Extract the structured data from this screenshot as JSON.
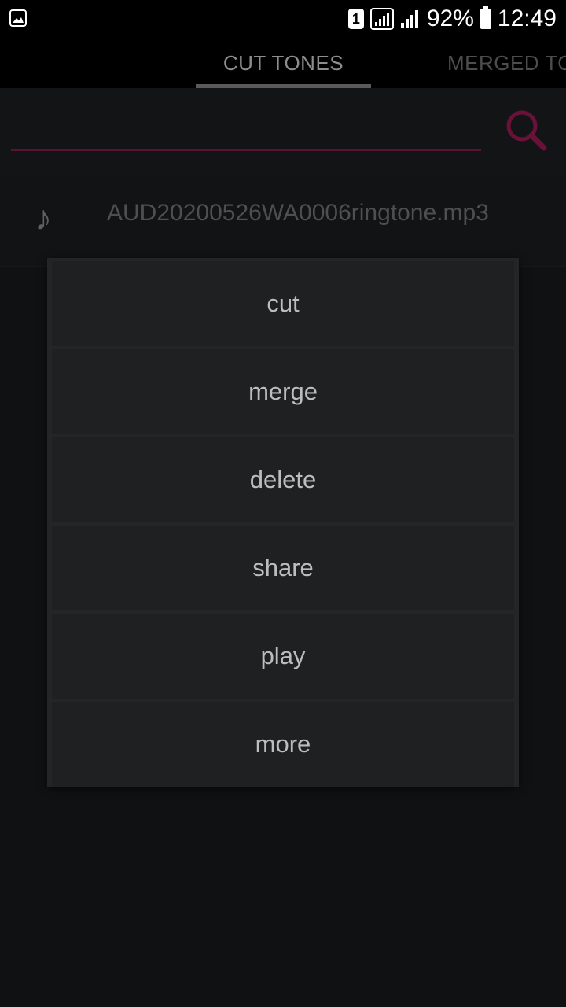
{
  "status_bar": {
    "sim_label": "1",
    "battery_percent": "92%",
    "time": "12:49",
    "icons": [
      "gallery-icon",
      "sim-icon",
      "wifi-signal-icon",
      "cell-signal-icon",
      "battery-icon"
    ]
  },
  "tabs": [
    {
      "label": "CUT TONES",
      "selected": true
    },
    {
      "label": "MERGED TONES",
      "selected": false
    }
  ],
  "search": {
    "value": "",
    "placeholder": "",
    "icon": "search-icon",
    "accent_color": "#6b1038"
  },
  "list": {
    "items": [
      {
        "icon": "music-note-icon",
        "name": "AUD20200526WA0006ringtone.mp3"
      }
    ]
  },
  "context_menu": {
    "items": [
      {
        "label": "cut"
      },
      {
        "label": "merge"
      },
      {
        "label": "delete"
      },
      {
        "label": "share"
      },
      {
        "label": "play"
      },
      {
        "label": "more"
      }
    ]
  }
}
